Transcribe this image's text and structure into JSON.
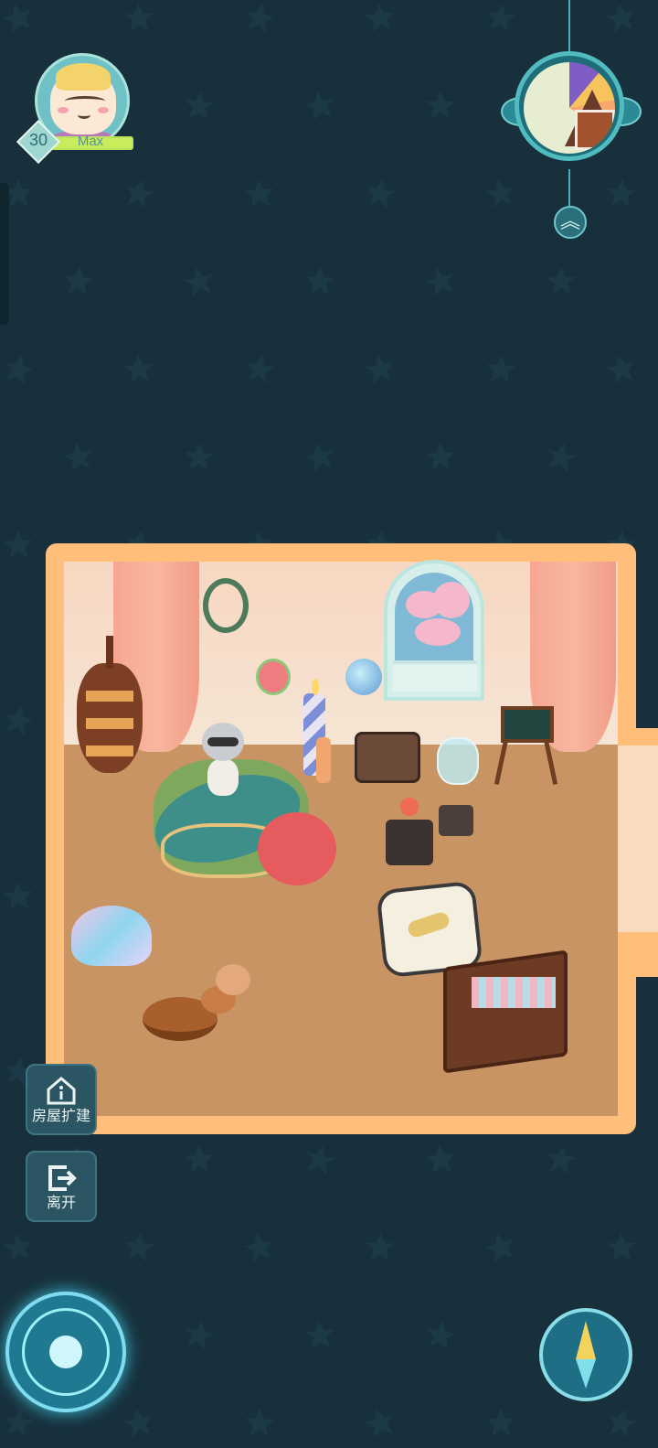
{
  "player": {
    "level": "30",
    "xp_label": "Max",
    "xp_progress": 1.0
  },
  "buttons": {
    "expand_house_label": "房屋扩建",
    "leave_label": "离开",
    "collapse_icon": "chevron-double-up-icon"
  },
  "colors": {
    "background": "#17303c",
    "room_frame": "#ffbf7b",
    "floor": "#c99464"
  }
}
